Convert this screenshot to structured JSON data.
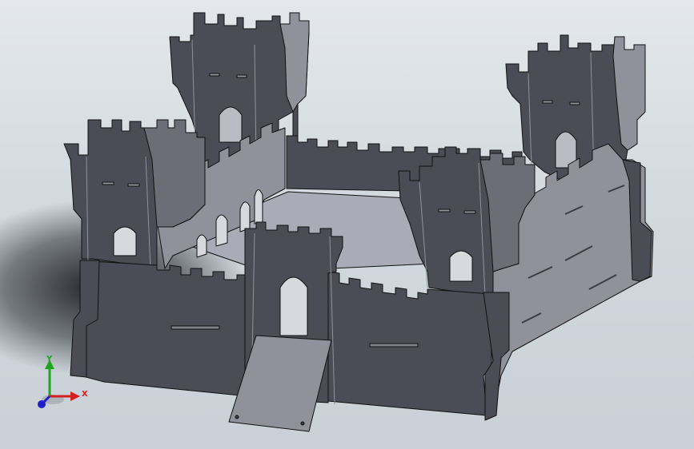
{
  "scene": {
    "model": "castle-kit",
    "colors": {
      "background_top": "#e4e8ec",
      "background_bottom": "#c9d0d7",
      "panel_dark": "#4a4d55",
      "panel_light": "#8f929b",
      "panel_mid": "#6b6e77",
      "edge": "#111111",
      "floor": "#a9acb6"
    }
  },
  "triad": {
    "x_label": "X",
    "y_label": "Y",
    "x_color": "#d42020",
    "y_color": "#1fa51f",
    "z_color": "#2020c8"
  }
}
